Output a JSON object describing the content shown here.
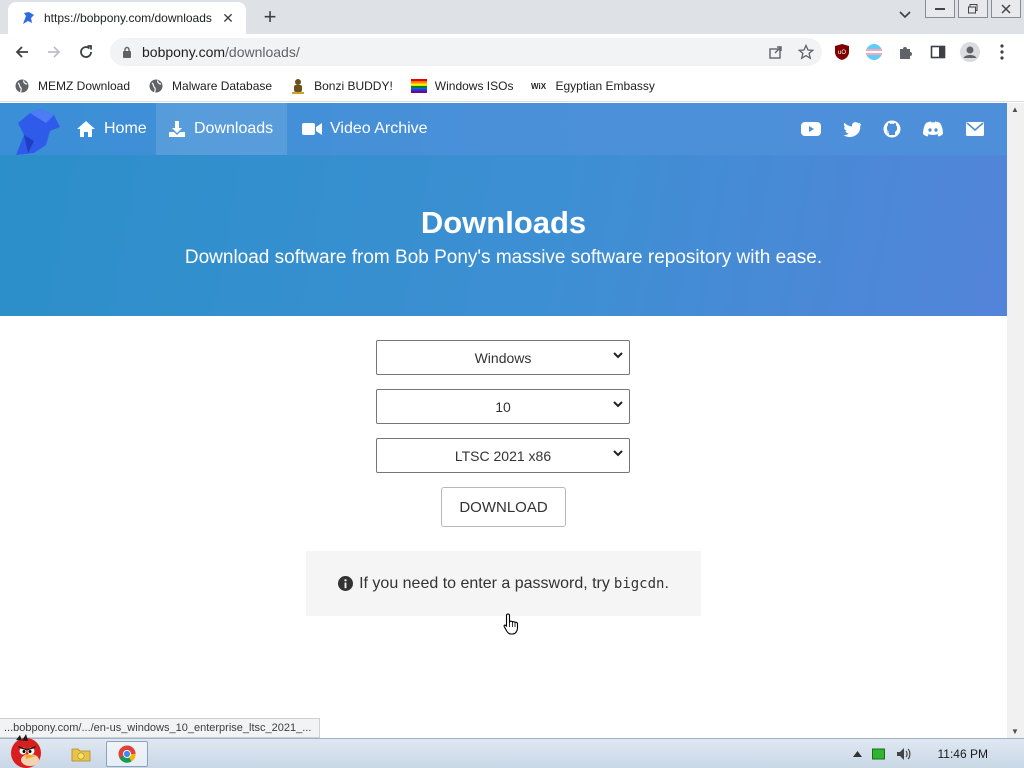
{
  "browser": {
    "tab": {
      "title": "https://bobpony.com/downloads"
    },
    "omnibox": {
      "host": "bobpony.com",
      "path": "/downloads/"
    },
    "bookmarks": [
      {
        "label": "MEMZ Download",
        "icon": "globe-icon"
      },
      {
        "label": "Malware Database",
        "icon": "globe-icon"
      },
      {
        "label": "Bonzi BUDDY!",
        "icon": "bonzi-icon"
      },
      {
        "label": "Windows ISOs",
        "icon": "rainbow-flag-icon"
      },
      {
        "label": "Egyptian Embassy",
        "icon": "wix-icon"
      }
    ],
    "status_url": "...bobpony.com/.../en-us_windows_10_enterprise_ltsc_2021_..."
  },
  "site": {
    "nav": {
      "home": "Home",
      "downloads": "Downloads",
      "video_archive": "Video Archive"
    },
    "hero": {
      "title": "Downloads",
      "subtitle": "Download software from Bob Pony's massive software repository with ease."
    },
    "form": {
      "os": "Windows",
      "version": "10",
      "edition": "LTSC 2021 x86",
      "download_label": "DOWNLOAD"
    },
    "notice": {
      "text": "If you need to enter a password, try",
      "password": "bigcdn",
      "suffix": "."
    }
  },
  "taskbar": {
    "clock": "11:46 PM"
  },
  "colors": {
    "nav_bg": "#4a90d9",
    "hero_bg": "#3d8fd3",
    "notice_bg": "#f5f5f5"
  }
}
